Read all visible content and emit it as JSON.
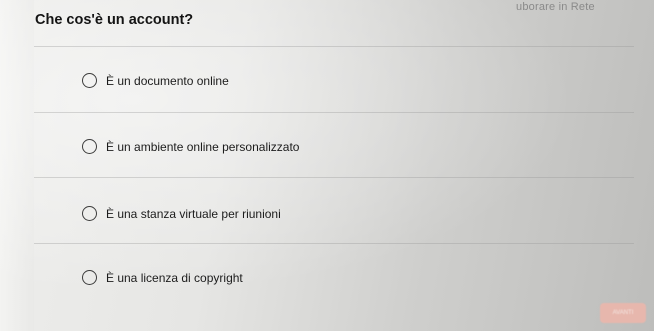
{
  "header": {
    "course_link": "uborare in Rete"
  },
  "quiz": {
    "question": "Che cos'è un account?",
    "options": [
      {
        "label": "È un documento online",
        "selected": false
      },
      {
        "label": "È un ambiente online personalizzato",
        "selected": false
      },
      {
        "label": "È una stanza virtuale per riunioni",
        "selected": false
      },
      {
        "label": "È una licenza di copyright",
        "selected": false
      }
    ]
  },
  "footer": {
    "next_label": "AVANTI"
  },
  "colors": {
    "background": "#e6e6e4",
    "radio_border": "#3c3c3c",
    "button": "#e7b7ad"
  }
}
